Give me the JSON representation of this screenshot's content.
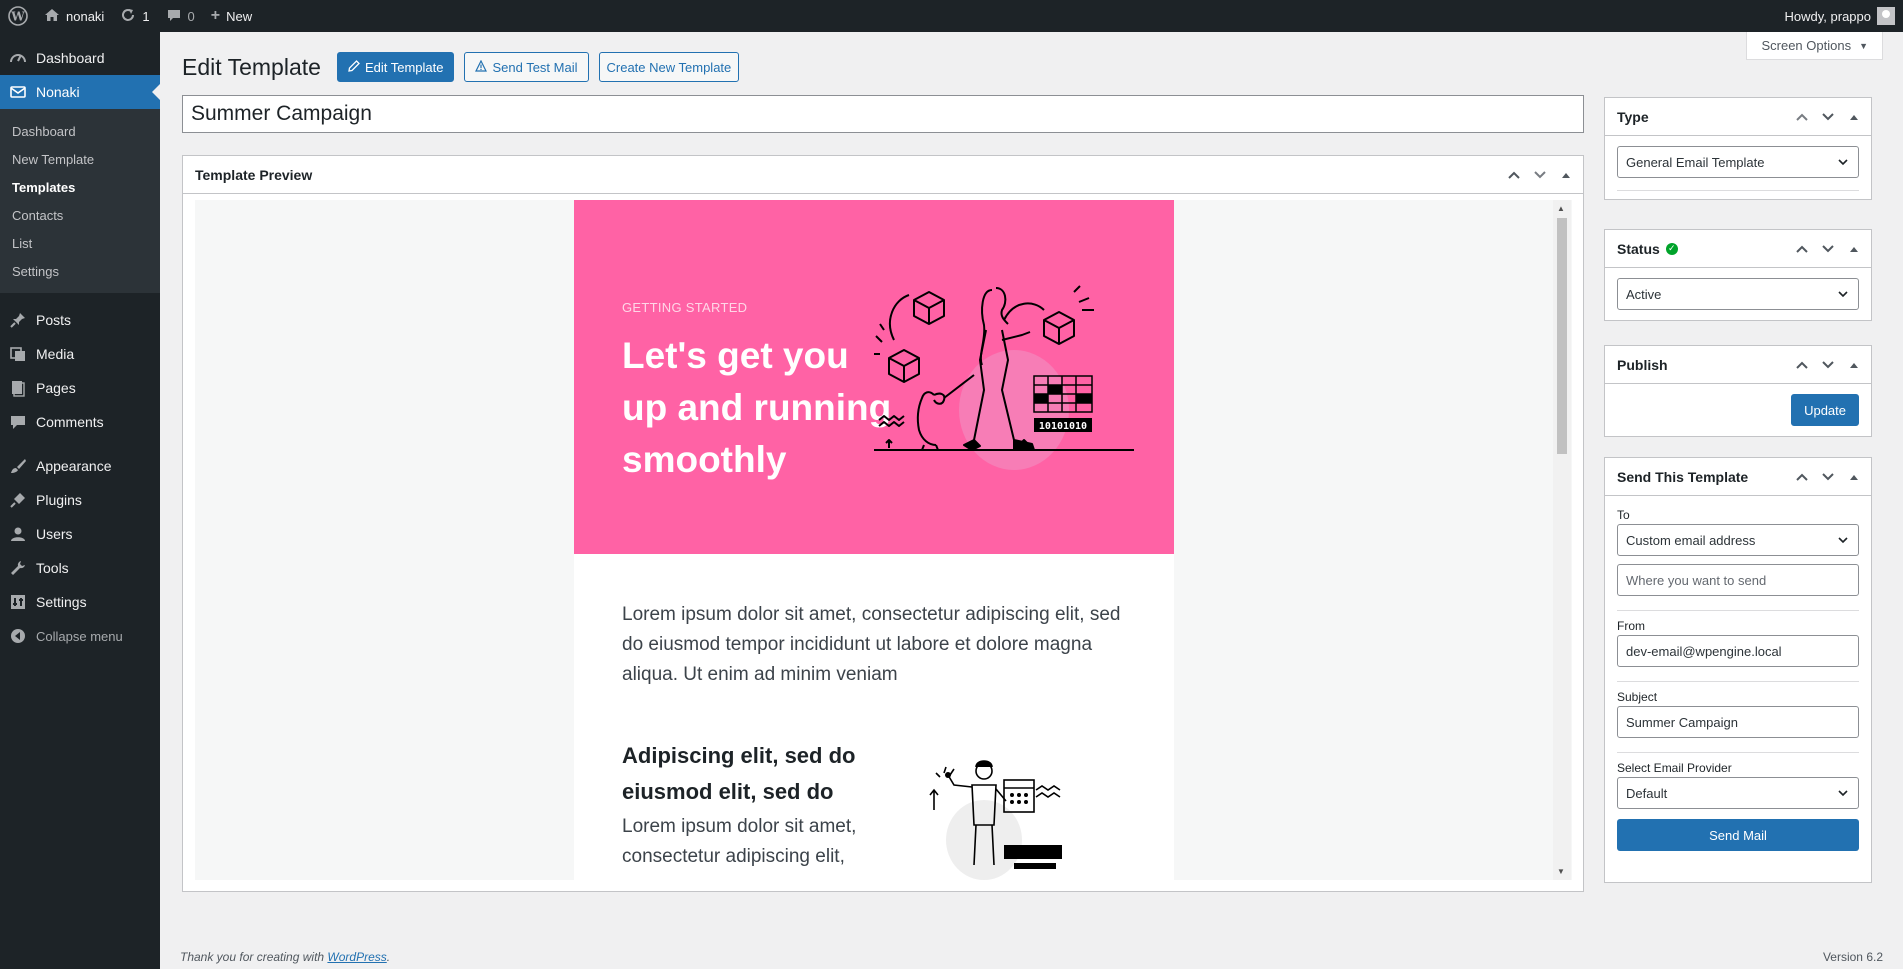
{
  "adminbar": {
    "site_name": "nonaki",
    "updates_count": "1",
    "comments_count": "0",
    "new_label": "New",
    "howdy": "Howdy, prappo"
  },
  "sidebar": {
    "dashboard": "Dashboard",
    "plugin": "Nonaki",
    "submenu": [
      "Dashboard",
      "New Template",
      "Templates",
      "Contacts",
      "List",
      "Settings"
    ],
    "posts": "Posts",
    "media": "Media",
    "pages": "Pages",
    "comments": "Comments",
    "appearance": "Appearance",
    "plugins": "Plugins",
    "users": "Users",
    "tools": "Tools",
    "settings": "Settings",
    "collapse": "Collapse menu"
  },
  "header": {
    "title": "Edit Template",
    "edit_btn": "Edit Template",
    "test_btn": "Send Test Mail",
    "create_btn": "Create New Template",
    "screen_options": "Screen Options"
  },
  "template": {
    "name": "Summer Campaign",
    "preview_title": "Template Preview",
    "kicker": "GETTING STARTED",
    "hero_title": "Let's get you up and running smoothly",
    "body": "Lorem ipsum dolor sit amet, consectetur adipiscing elit, sed do eiusmod tempor incididunt ut labore et dolore magna aliqua. Ut enim ad minim veniam",
    "feature_title": "Adipiscing elit, sed do eiusmod elit, sed do",
    "feature_text": "Lorem ipsum dolor sit amet, consectetur adipiscing elit,",
    "binary": "10101010"
  },
  "type_box": {
    "title": "Type",
    "value": "General Email Template"
  },
  "status_box": {
    "title": "Status",
    "value": "Active"
  },
  "publish_box": {
    "title": "Publish",
    "update": "Update"
  },
  "send_box": {
    "title": "Send This Template",
    "to_label": "To",
    "to_value": "Custom email address",
    "to_placeholder": "Where you want to send",
    "from_label": "From",
    "from_value": "dev-email@wpengine.local",
    "subject_label": "Subject",
    "subject_value": "Summer Campaign",
    "provider_label": "Select Email Provider",
    "provider_value": "Default",
    "send_button": "Send Mail"
  },
  "footer": {
    "thanks_prefix": "Thank you for creating with",
    "wp_link": "WordPress",
    "version": "Version 6.2"
  },
  "colors": {
    "accent": "#2271b1",
    "admin_dark": "#1d2327",
    "hero_pink": "#ff62a5",
    "status_green": "#00a32a"
  }
}
